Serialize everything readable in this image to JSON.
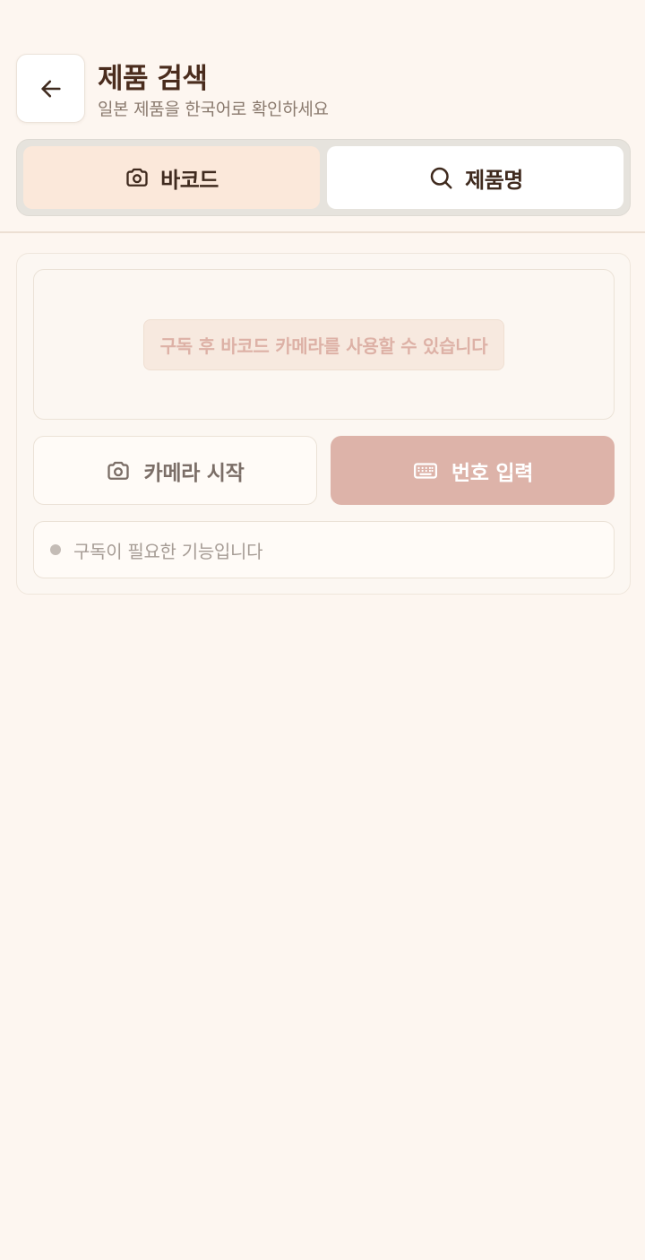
{
  "header": {
    "title": "제품 검색",
    "subtitle": "일본 제품을 한국어로 확인하세요",
    "back_icon": "arrow-left-icon"
  },
  "tabs": [
    {
      "label": "바코드",
      "icon": "camera-icon",
      "active": true
    },
    {
      "label": "제품명",
      "icon": "search-icon",
      "active": false
    }
  ],
  "scanner": {
    "notice": "구독 후 바코드 카메라를 사용할 수 있습니다"
  },
  "actions": {
    "camera_label": "카메라 시작",
    "camera_icon": "camera-icon",
    "number_label": "번호 입력",
    "number_icon": "keyboard-icon"
  },
  "status": {
    "text": "구독이 필요한 기능입니다"
  },
  "colors": {
    "background": "#fdf6f0",
    "accent": "#ddb3a9",
    "title": "#4a2c1d",
    "active_tab": "#fbe8da"
  }
}
